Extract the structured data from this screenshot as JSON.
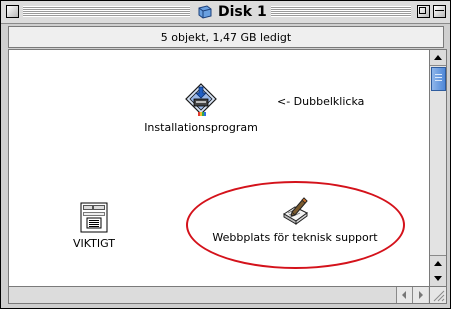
{
  "window": {
    "title": "Disk 1"
  },
  "infobar": {
    "text": "5 objekt, 1,47 GB ledigt"
  },
  "icons": {
    "installer": {
      "label": "Installationsprogram"
    },
    "viktigt": {
      "label": "VIKTIGT"
    },
    "webb": {
      "label": "Webbplats för teknisk support"
    }
  },
  "annotation": {
    "note": "<- Dubbelklicka",
    "circle_color": "#d4121b"
  },
  "icon_names": [
    "disk-icon",
    "installer-icon",
    "document-icon",
    "web-pen-icon"
  ],
  "colors": {
    "scroll_thumb": "#4f88d8",
    "title_bar": "#dcdcdc"
  }
}
